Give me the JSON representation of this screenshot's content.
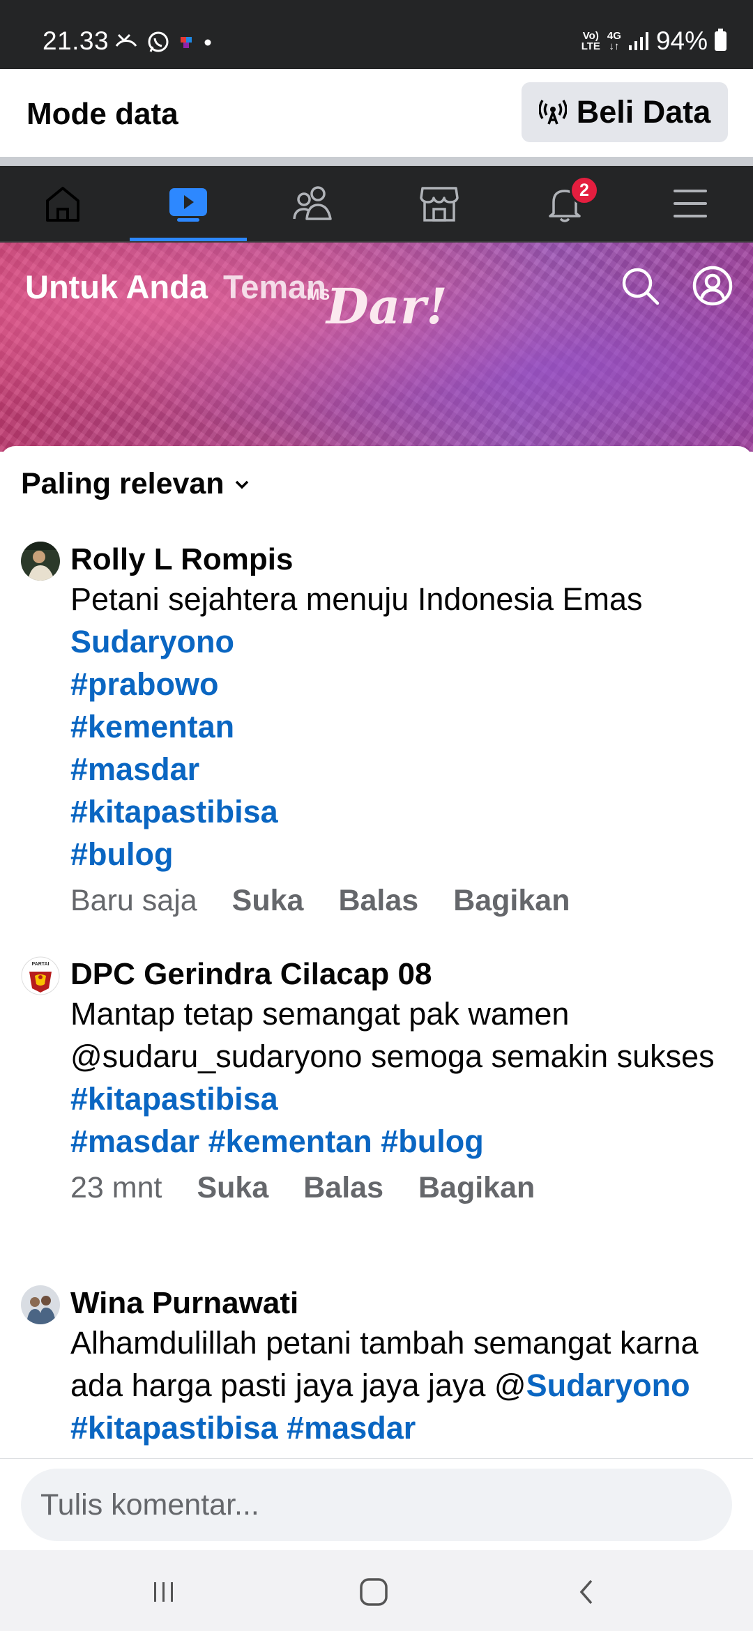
{
  "status_bar": {
    "time": "21.33",
    "network": "VoLTE 4G",
    "battery": "94%"
  },
  "data_mode": {
    "title": "Mode data",
    "buy_label": "Beli Data"
  },
  "nav": {
    "items": [
      "home-icon",
      "video-icon",
      "friends-icon",
      "marketplace-icon",
      "notifications-icon",
      "menu-icon"
    ],
    "active": "video-icon",
    "notification_count": "2",
    "accent": "#2d88ff"
  },
  "banner": {
    "tabs": [
      "Untuk Anda",
      "Teman"
    ],
    "logo_text": "Dar!",
    "logo_prefix": "MS"
  },
  "comments_section": {
    "sort_label": "Paling relevan",
    "comments": [
      {
        "author": "Rolly L Rompis",
        "text": "Petani sejahtera menuju Indonesia Emas",
        "tags": [
          "Sudaryono",
          "#prabowo",
          "#kementan",
          "#masdar",
          "#kitapastibisa",
          "#bulog"
        ],
        "time": "Baru saja",
        "actions": [
          "Suka",
          "Balas",
          "Bagikan"
        ]
      },
      {
        "author": "DPC Gerindra Cilacap 08",
        "text": "Mantap tetap semangat pak wamen @sudaru_sudaryono semoga semakin sukses",
        "tags": [
          "#kitapastibisa",
          "#masdar #kementan #bulog"
        ],
        "avatar_label": "PARTAI",
        "time": "23 mnt",
        "actions": [
          "Suka",
          "Balas",
          "Bagikan"
        ]
      },
      {
        "author": "Wina Purnawati",
        "text": "Alhamdulillah petani tambah semangat karna ada harga pasti jaya jaya jaya",
        "mention_prefix": "@",
        "inline_tags": "Sudaryono #kitapastibisa #masdar"
      }
    ]
  },
  "compose": {
    "placeholder": "Tulis komentar..."
  },
  "colors": {
    "link": "#0a66c2",
    "dark_bar": "#242526",
    "badge": "#e41e3f"
  }
}
